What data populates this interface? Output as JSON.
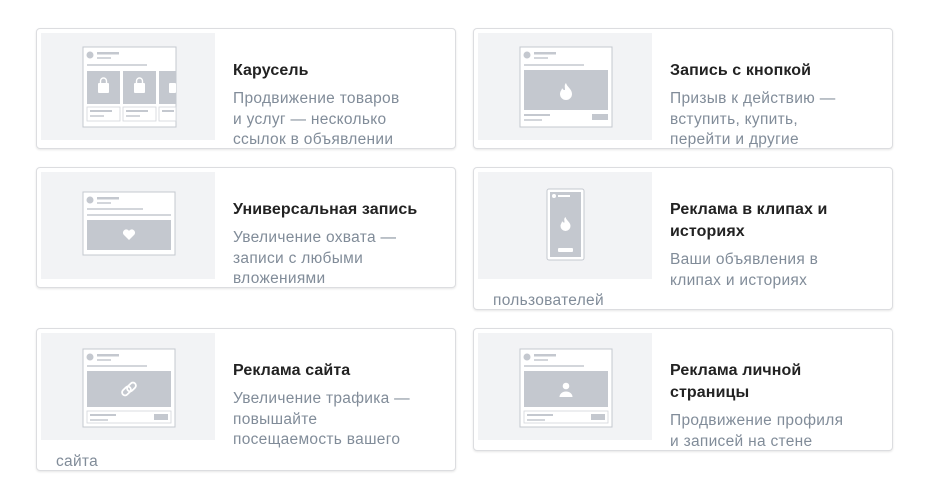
{
  "colors": {
    "card_border": "#dcdde0",
    "thumb_bg": "#f2f3f5",
    "title": "#222222",
    "desc": "#818c99",
    "mock_block": "#c4c8cf",
    "mock_line": "#d3d6db"
  },
  "ad_formats": [
    {
      "title": "Карусель",
      "description": "Продвижение товаров\nи услуг — несколько\nссылок в объявлении",
      "icon": "shopping-bag-icon"
    },
    {
      "title": "Запись с кнопкой",
      "description": "Призыв к действию —\nвступить, купить,\nперейти и другие",
      "icon": "flame-icon"
    },
    {
      "title": "Универсальная запись",
      "description": "Увеличение охвата —\nзаписи с любыми\nвложениями",
      "icon": "heart-icon"
    },
    {
      "title": "Реклама в клипах и\nисториях",
      "description": "Ваши объявления в\nклипах и историях",
      "overflow_text": "пользователей",
      "icon": "flame-icon"
    },
    {
      "title": "Реклама сайта",
      "description": "Увеличение трафика —\nповышайте\nпосещаемость вашего",
      "overflow_text": "сайта",
      "icon": "link-icon"
    },
    {
      "title": "Реклама личной\nстраницы",
      "description": "Продвижение профиля\nи записей на стене",
      "icon": "user-icon"
    }
  ]
}
